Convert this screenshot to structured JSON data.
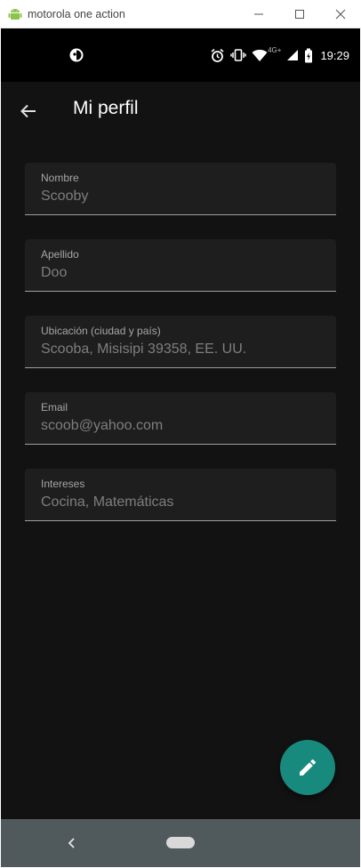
{
  "window": {
    "title": "motorola one action",
    "minimize_icon": "minimize-icon",
    "maximize_icon": "maximize-icon",
    "close_icon": "close-icon"
  },
  "statusbar": {
    "time": "19:29",
    "network_label": "4G+",
    "icons": [
      "app-notification-icon",
      "alarm-icon",
      "vibrate-icon",
      "wifi-icon",
      "signal-icon",
      "battery-icon"
    ]
  },
  "appbar": {
    "title": "Mi perfil",
    "back_icon": "arrow-back-icon"
  },
  "fields": [
    {
      "label": "Nombre",
      "value": "Scooby"
    },
    {
      "label": "Apellido",
      "value": "Doo"
    },
    {
      "label": "Ubicación (ciudad y país)",
      "value": "Scooba, Misisipi 39358, EE. UU."
    },
    {
      "label": "Email",
      "value": "scoob@yahoo.com"
    },
    {
      "label": "Intereses",
      "value": "Cocina, Matemáticas"
    }
  ],
  "fab": {
    "icon": "edit-pencil-icon",
    "color": "#188a7d"
  },
  "navbar": {
    "back_icon": "nav-back-icon",
    "home_icon": "nav-home-pill"
  },
  "colors": {
    "background": "#121212",
    "field_bg": "#1e1e1e",
    "navbar": "#505a5d",
    "accent": "#188a7d"
  }
}
